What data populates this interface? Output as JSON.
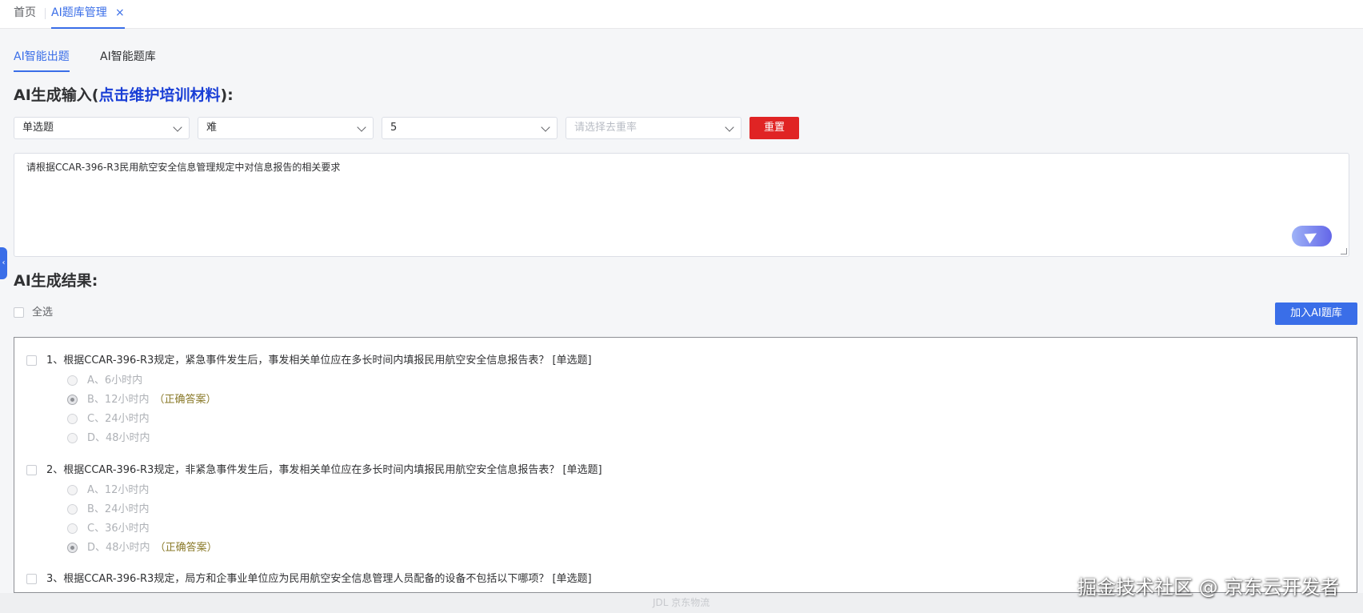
{
  "nav": {
    "home_label": "首页",
    "active_tab_label": "AI题库管理",
    "close_glyph": "×"
  },
  "subtabs": {
    "generate_label": "AI智能出题",
    "bank_label": "AI智能题库"
  },
  "input_section": {
    "title_prefix": "AI生成输入(",
    "title_link": "点击维护培训材料",
    "title_suffix": "):",
    "question_type": "单选题",
    "difficulty": "难",
    "count": "5",
    "dedupe_placeholder": "请选择去重率",
    "reset_label": "重置",
    "prompt_text": "请根据CCAR-396-R3民用航空安全信息管理规定中对信息报告的相关要求"
  },
  "result_section": {
    "title": "AI生成结果:",
    "select_all_label": "全选",
    "add_button_label": "加入AI题库",
    "correct_tag": "（正确答案）",
    "questions": [
      {
        "text": "1、根据CCAR-396-R3规定，紧急事件发生后，事发相关单位应在多长时间内填报民用航空安全信息报告表？ [单选题]",
        "options": [
          "A、6小时内",
          "B、12小时内",
          "C、24小时内",
          "D、48小时内"
        ],
        "correct_index": 1
      },
      {
        "text": "2、根据CCAR-396-R3规定，非紧急事件发生后，事发相关单位应在多长时间内填报民用航空安全信息报告表？ [单选题]",
        "options": [
          "A、12小时内",
          "B、24小时内",
          "C、36小时内",
          "D、48小时内"
        ],
        "correct_index": 3
      },
      {
        "text": "3、根据CCAR-396-R3规定，局方和企事业单位应为民用航空安全信息管理人员配备的设备不包括以下哪项？ [单选题]",
        "options": [],
        "correct_index": -1
      }
    ]
  },
  "footer": {
    "brand_text": "JDL 京东物流",
    "watermark": "掘金技术社区 @ 京东云开发者"
  },
  "colors": {
    "accent": "#3a6ee8",
    "danger": "#e02424",
    "link": "#1a3fd6"
  },
  "icons": {
    "select_chevron": "chevron-down-icon",
    "send": "send-icon",
    "collapse": "chevron-left-icon"
  }
}
